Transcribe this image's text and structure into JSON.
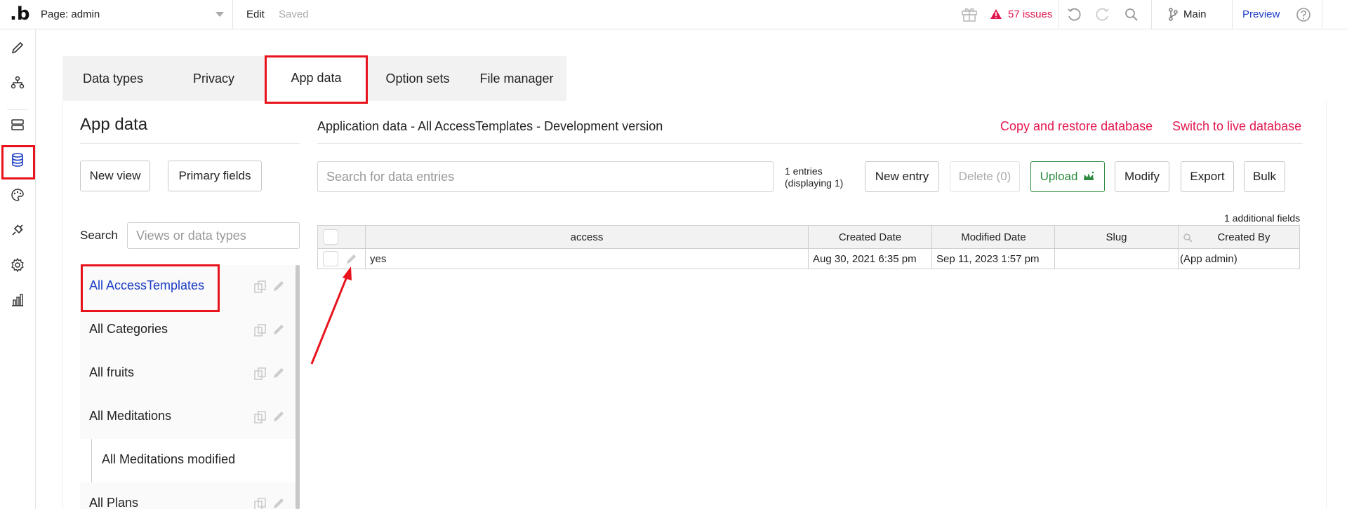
{
  "topbar": {
    "logo": ".b",
    "page_label": "Page: admin",
    "edit_label": "Edit",
    "saved_label": "Saved",
    "issues_label": "57 issues",
    "branch_label": "Main",
    "preview_label": "Preview"
  },
  "rail": {
    "icons": [
      "pencil-icon",
      "workflow-icon",
      "database-stack-icon",
      "database-icon",
      "palette-icon",
      "plugin-icon",
      "settings-icon",
      "chart-icon"
    ],
    "active": "database-icon"
  },
  "tabs": [
    {
      "label": "Data types"
    },
    {
      "label": "Privacy"
    },
    {
      "label": "App data",
      "active": true
    },
    {
      "label": "Option sets"
    },
    {
      "label": "File manager"
    }
  ],
  "left_panel": {
    "title": "App data",
    "new_view_label": "New view",
    "primary_fields_label": "Primary fields",
    "search_label": "Search",
    "search_placeholder": "Views or data types",
    "views": [
      {
        "name": "All AccessTemplates",
        "active": true
      },
      {
        "name": "All Categories"
      },
      {
        "name": "All fruits"
      },
      {
        "name": "All Meditations"
      },
      {
        "name": "All Meditations modified",
        "sub": true
      },
      {
        "name": "All Plans"
      }
    ]
  },
  "right_panel": {
    "heading": "Application data - All AccessTemplates - Development version",
    "copy_restore_label": "Copy and restore database",
    "switch_live_label": "Switch to live database",
    "search_placeholder": "Search for data entries",
    "entries_line1": "1 entries",
    "entries_line2": "(displaying 1)",
    "new_entry_label": "New entry",
    "delete_label": "Delete (0)",
    "upload_label": "Upload",
    "modify_label": "Modify",
    "export_label": "Export",
    "bulk_label": "Bulk",
    "additional_fields": "1 additional fields",
    "table": {
      "columns": [
        "access",
        "Created Date",
        "Modified Date",
        "Slug",
        "Created By"
      ],
      "rows": [
        {
          "access": "yes",
          "created": "Aug 30, 2021 6:35 pm",
          "modified": "Sep 11, 2023 1:57 pm",
          "slug": "",
          "created_by": "(App admin)"
        }
      ]
    }
  },
  "colors": {
    "accent_blue": "#1a3cc4",
    "issues_pink": "#e3174f",
    "highlight_red": "#e8131c",
    "upload_green": "#2e8b3f"
  }
}
